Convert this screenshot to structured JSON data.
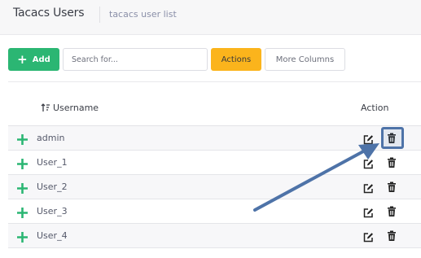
{
  "header": {
    "title": "Tacacs Users",
    "subtitle": "tacacs user list"
  },
  "toolbar": {
    "add_label": "Add",
    "search_placeholder": "Search for...",
    "actions_label": "Actions",
    "more_columns_label": "More Columns"
  },
  "table": {
    "columns": {
      "username": "Username",
      "action": "Action"
    },
    "rows": [
      {
        "username": "admin"
      },
      {
        "username": "User_1"
      },
      {
        "username": "User_2"
      },
      {
        "username": "User_3"
      },
      {
        "username": "User_4"
      }
    ]
  },
  "colors": {
    "add_button": "#2bb673",
    "actions_button": "#fbb41c",
    "annotation": "#4e73a8"
  },
  "icons": {
    "add": "plus-icon",
    "sort": "sort-icon",
    "row_expand": "plus-icon",
    "edit": "edit-icon",
    "delete": "trash-icon"
  }
}
